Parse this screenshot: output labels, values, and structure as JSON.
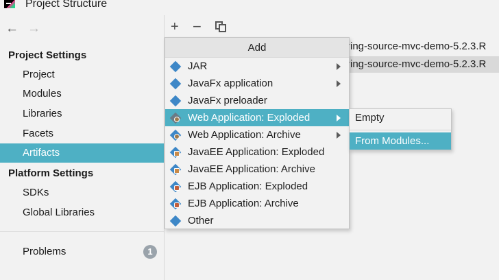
{
  "window": {
    "title": "Project Structure"
  },
  "nav": {
    "back_icon": "←",
    "forward_icon": "→"
  },
  "sidebar": {
    "project_settings_header": "Project Settings",
    "project_items": [
      {
        "label": "Project"
      },
      {
        "label": "Modules"
      },
      {
        "label": "Libraries"
      },
      {
        "label": "Facets"
      },
      {
        "label": "Artifacts",
        "selected": true
      }
    ],
    "platform_settings_header": "Platform Settings",
    "platform_items": [
      {
        "label": "SDKs"
      },
      {
        "label": "Global Libraries"
      }
    ],
    "problems": {
      "label": "Problems",
      "count": "1"
    }
  },
  "toolbar": {
    "add_icon": "+",
    "remove_icon": "−"
  },
  "artifacts_list": [
    "ring-source-mvc-demo-5.2.3.R",
    "ring-source-mvc-demo-5.2.3.R"
  ],
  "add_menu": {
    "header": "Add",
    "items": [
      {
        "label": "JAR",
        "submenu": true,
        "highlighted": false
      },
      {
        "label": "JavaFx application",
        "submenu": true,
        "highlighted": false
      },
      {
        "label": "JavaFx preloader",
        "submenu": false,
        "highlighted": false
      },
      {
        "label": "Web Application: Exploded",
        "submenu": true,
        "highlighted": true
      },
      {
        "label": "Web Application: Archive",
        "submenu": true,
        "highlighted": false
      },
      {
        "label": "JavaEE Application: Exploded",
        "submenu": false,
        "highlighted": false
      },
      {
        "label": "JavaEE Application: Archive",
        "submenu": false,
        "highlighted": false
      },
      {
        "label": "EJB Application: Exploded",
        "submenu": false,
        "highlighted": false
      },
      {
        "label": "EJB Application: Archive",
        "submenu": false,
        "highlighted": false
      },
      {
        "label": "Other",
        "submenu": false,
        "highlighted": false
      }
    ]
  },
  "submenu": {
    "items": [
      {
        "label": "Empty",
        "highlighted": false
      },
      {
        "label": "From Modules...",
        "highlighted": true
      }
    ]
  },
  "colors": {
    "selection": "#4eb0c4",
    "icon_blue": "#3d87c7",
    "background": "#f2f2f2"
  }
}
